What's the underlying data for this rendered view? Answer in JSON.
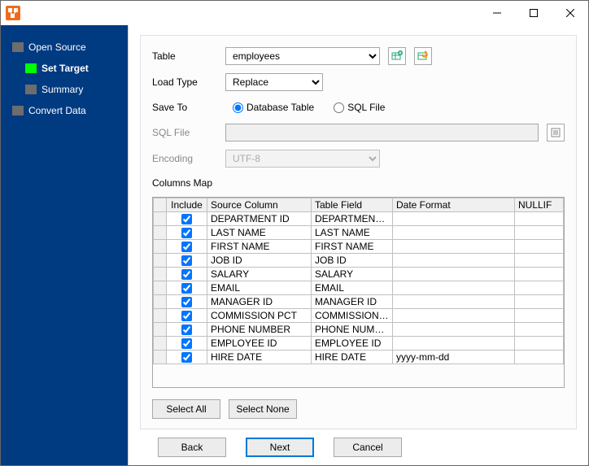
{
  "sidebar": {
    "items": [
      {
        "label": "Open Source"
      },
      {
        "label": "Set Target"
      },
      {
        "label": "Summary"
      },
      {
        "label": "Convert Data"
      }
    ]
  },
  "form": {
    "table": {
      "label": "Table",
      "value": "employees"
    },
    "load_type": {
      "label": "Load Type",
      "value": "Replace"
    },
    "save_to": {
      "label": "Save To",
      "options": [
        "Database Table",
        "SQL File"
      ],
      "selected": 0
    },
    "sql_file": {
      "label": "SQL File",
      "value": ""
    },
    "encoding": {
      "label": "Encoding",
      "value": "UTF-8"
    },
    "columns_map_label": "Columns Map"
  },
  "grid": {
    "headers": [
      "Include",
      "Source Column",
      "Table Field",
      "Date Format",
      "NULLIF"
    ],
    "rows": [
      {
        "include": true,
        "source": "DEPARTMENT ID",
        "field": "DEPARTMENT ID",
        "date": "",
        "nullif": ""
      },
      {
        "include": true,
        "source": "LAST NAME",
        "field": "LAST NAME",
        "date": "",
        "nullif": ""
      },
      {
        "include": true,
        "source": "FIRST NAME",
        "field": "FIRST NAME",
        "date": "",
        "nullif": ""
      },
      {
        "include": true,
        "source": "JOB ID",
        "field": "JOB ID",
        "date": "",
        "nullif": ""
      },
      {
        "include": true,
        "source": "SALARY",
        "field": "SALARY",
        "date": "",
        "nullif": ""
      },
      {
        "include": true,
        "source": "EMAIL",
        "field": "EMAIL",
        "date": "",
        "nullif": ""
      },
      {
        "include": true,
        "source": "MANAGER ID",
        "field": "MANAGER ID",
        "date": "",
        "nullif": ""
      },
      {
        "include": true,
        "source": "COMMISSION PCT",
        "field": "COMMISSION PCT",
        "date": "",
        "nullif": ""
      },
      {
        "include": true,
        "source": "PHONE NUMBER",
        "field": "PHONE NUMBER",
        "date": "",
        "nullif": ""
      },
      {
        "include": true,
        "source": "EMPLOYEE ID",
        "field": "EMPLOYEE ID",
        "date": "",
        "nullif": ""
      },
      {
        "include": true,
        "source": "HIRE DATE",
        "field": "HIRE DATE",
        "date": "yyyy-mm-dd",
        "nullif": ""
      }
    ]
  },
  "buttons": {
    "select_all": "Select All",
    "select_none": "Select None",
    "back": "Back",
    "next": "Next",
    "cancel": "Cancel"
  }
}
